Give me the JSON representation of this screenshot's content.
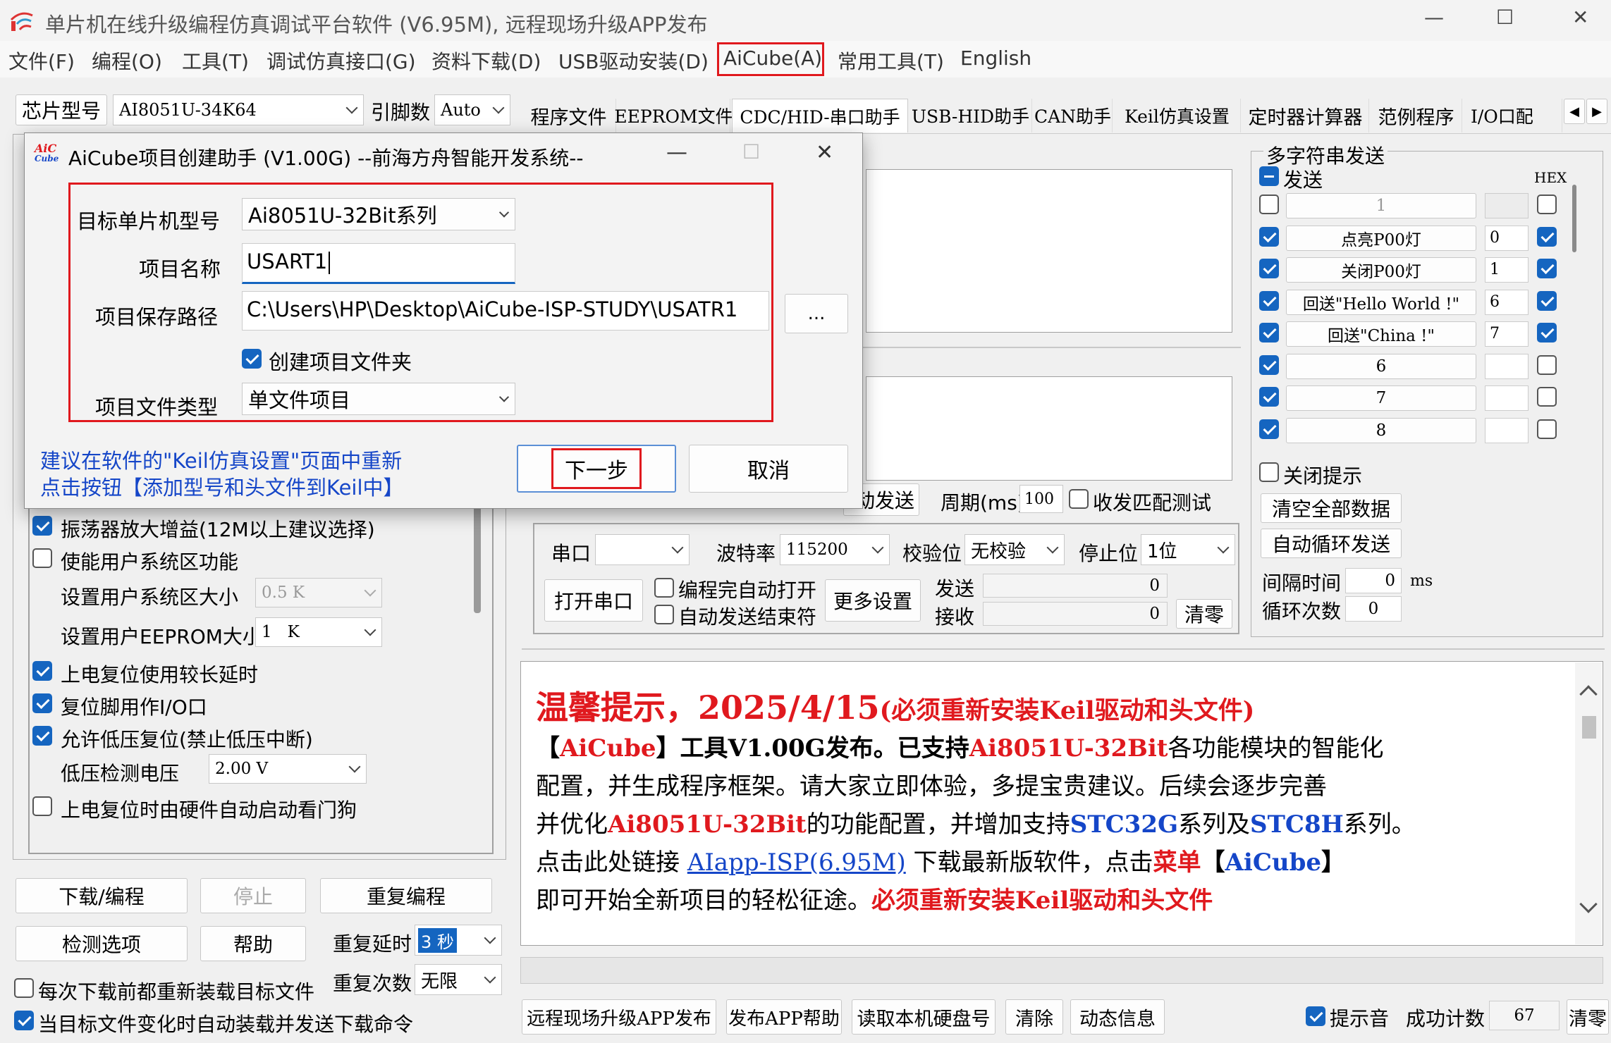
{
  "window": {
    "title": "单片机在线升级编程仿真调试平台软件 (V6.95M), 远程现场升级APP发布",
    "controls": [
      "—",
      "☐",
      "✕"
    ]
  },
  "menu": [
    "文件(F)",
    "编程(O)",
    "工具(T)",
    "调试仿真接口(G)",
    "资料下载(D)",
    "USB驱动安装(D)",
    "AiCube(A)",
    "常用工具(T)",
    "English"
  ],
  "toolbar": {
    "chip_label": "芯片型号",
    "chip_value": "AI8051U-34K64",
    "pin_label": "引脚数",
    "pin_value": "Auto"
  },
  "tabs": [
    "程序文件",
    "EEPROM文件",
    "CDC/HID-串口助手",
    "USB-HID助手",
    "CAN助手",
    "Keil仿真设置",
    "定时器计算器",
    "范例程序",
    "I/O口配"
  ],
  "left_options": {
    "osc_gain": "振荡器放大增益(12M以上建议选择)",
    "user_sys": "使能用户系统区功能",
    "user_sys_size_label": "设置用户系统区大小",
    "user_sys_size_value": "0.5 K",
    "user_eeprom_label": "设置用户EEPROM大小",
    "user_eeprom_value": "1   K",
    "long_delay": "上电复位使用较长延时",
    "reset_io": "复位脚用作I/O口",
    "low_volt": "允许低压复位(禁止低压中断)",
    "low_volt_label": "低压检测电压",
    "low_volt_value": "2.00 V",
    "watchdog": "上电复位时由硬件自动启动看门狗"
  },
  "left_buttons": {
    "download": "下载/编程",
    "stop": "停止",
    "reprogram": "重复编程",
    "check": "检测选项",
    "help": "帮助",
    "repeat_delay_label": "重复延时",
    "repeat_delay_value": "3 秒",
    "repeat_count_label": "重复次数",
    "repeat_count_value": "无限",
    "reload_each": "每次下载前都重新装载目标文件",
    "auto_reload": "当目标文件变化时自动装载并发送下载命令"
  },
  "serial": {
    "auto_send": "动发送",
    "period_label": "周期(ms)",
    "period_value": "100",
    "match_test": "收发匹配测试",
    "port_label": "串口",
    "baud_label": "波特率",
    "baud_value": "115200",
    "parity_label": "校验位",
    "parity_value": "无校验",
    "stop_label": "停止位",
    "stop_value": "1位",
    "open_port": "打开串口",
    "auto_open": "编程完自动打开",
    "auto_end": "自动发送结束符",
    "more": "更多设置",
    "send_label": "发送",
    "send_count": "0",
    "recv_label": "接收",
    "recv_count": "0",
    "clear": "清零"
  },
  "multi_send": {
    "title": "多字符串发送",
    "send_header": "发送",
    "hex_header": "HEX",
    "rows": [
      {
        "label": "1",
        "value": "",
        "checked": false,
        "hex": false
      },
      {
        "label": "点亮P00灯",
        "value": "0",
        "checked": true,
        "hex": true
      },
      {
        "label": "关闭P00灯",
        "value": "1",
        "checked": true,
        "hex": true
      },
      {
        "label": "回送\"Hello World !\"",
        "value": "6",
        "checked": true,
        "hex": true
      },
      {
        "label": "回送\"China !\"",
        "value": "7",
        "checked": true,
        "hex": true
      },
      {
        "label": "6",
        "value": "",
        "checked": true,
        "hex": false
      },
      {
        "label": "7",
        "value": "",
        "checked": true,
        "hex": false
      },
      {
        "label": "8",
        "value": "",
        "checked": true,
        "hex": false
      }
    ],
    "close_tip": "关闭提示",
    "clear_all": "清空全部数据",
    "auto_loop": "自动循环发送",
    "interval_label": "间隔时间",
    "interval_value": "0",
    "interval_unit": "ms",
    "loop_label": "循环次数",
    "loop_value": "0"
  },
  "notice": {
    "heading": "温馨提示，2025/4/15",
    "heading_note": "(必须重新安装Keil驱动和头文件)",
    "l1_a": "【",
    "l1_b": "AiCube",
    "l1_c": "】工具V1.00G发布。已支持",
    "l1_d": "Ai8051U-32Bit",
    "l1_e": "各功能模块的智能化",
    "l2": "配置，并生成程序框架。请大家立即体验，多提宝贵建议。后续会逐步完善",
    "l3_a": "并优化",
    "l3_b": "Ai8051U-32Bit",
    "l3_c": "的功能配置，并增加支持",
    "l3_d": "STC32G",
    "l3_e": "系列及",
    "l3_f": "STC8H",
    "l3_g": "系列。",
    "l4_a": "点击此处链接 ",
    "l4_link": "AIapp-ISP(6.95M)",
    "l4_b": " 下载最新版软件，点击",
    "l4_c": "菜单",
    "l4_d": "【",
    "l4_e": "AiCube",
    "l4_f": "】",
    "l5_a": "即可开始全新项目的轻松征途。",
    "l5_b": "必须重新安装Keil驱动和头文件"
  },
  "bottom_bar": {
    "publish": "远程现场升级APP发布",
    "publish_help": "发布APP帮助",
    "read_disk": "读取本机硬盘号",
    "clear": "清除",
    "dynamic": "动态信息",
    "sound": "提示音",
    "success_label": "成功计数",
    "success_value": "67",
    "clear2": "清零"
  },
  "dialog": {
    "logo_top": "AiC",
    "logo_bottom": "Cube",
    "title": "AiCube项目创建助手 (V1.00G) --前海方舟智能开发系统--",
    "target_label": "目标单片机型号",
    "target_value": "Ai8051U-32Bit系列",
    "name_label": "项目名称",
    "name_value": "USART1",
    "path_label": "项目保存路径",
    "path_value": "C:\\Users\\HP\\Desktop\\AiCube-ISP-STUDY\\USATR1",
    "browse": "...",
    "create_folder": "创建项目文件夹",
    "type_label": "项目文件类型",
    "type_value": "单文件项目",
    "hint1": "建议在软件的\"Keil仿真设置\"页面中重新",
    "hint2": "点击按钮【添加型号和头文件到Keil中】",
    "next": "下一步",
    "cancel": "取消"
  },
  "colors": {
    "highlight_red": "#e0191e",
    "accent_blue": "#1565c0",
    "link_blue": "#1546c8"
  }
}
